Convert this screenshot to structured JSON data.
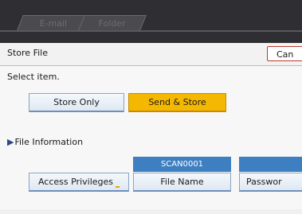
{
  "tabs": [
    {
      "label": "E-mail"
    },
    {
      "label": "Folder"
    }
  ],
  "header": {
    "title": "Store File",
    "cancel_label": "Can"
  },
  "main": {
    "select_label": "Select item.",
    "mode_buttons": [
      {
        "label": "Store Only",
        "selected": false
      },
      {
        "label": "Send & Store",
        "selected": true
      }
    ],
    "file_info_label": "File Information",
    "file_name_value": "SCAN0001",
    "access_privileges_label": "Access Privileges",
    "file_name_label": "File Name",
    "password_label": "Passwor"
  },
  "colors": {
    "topbar": "#2f2f33",
    "selected": "#f5b800",
    "value_box": "#3e7fc1",
    "cancel_border": "#c0392b"
  }
}
